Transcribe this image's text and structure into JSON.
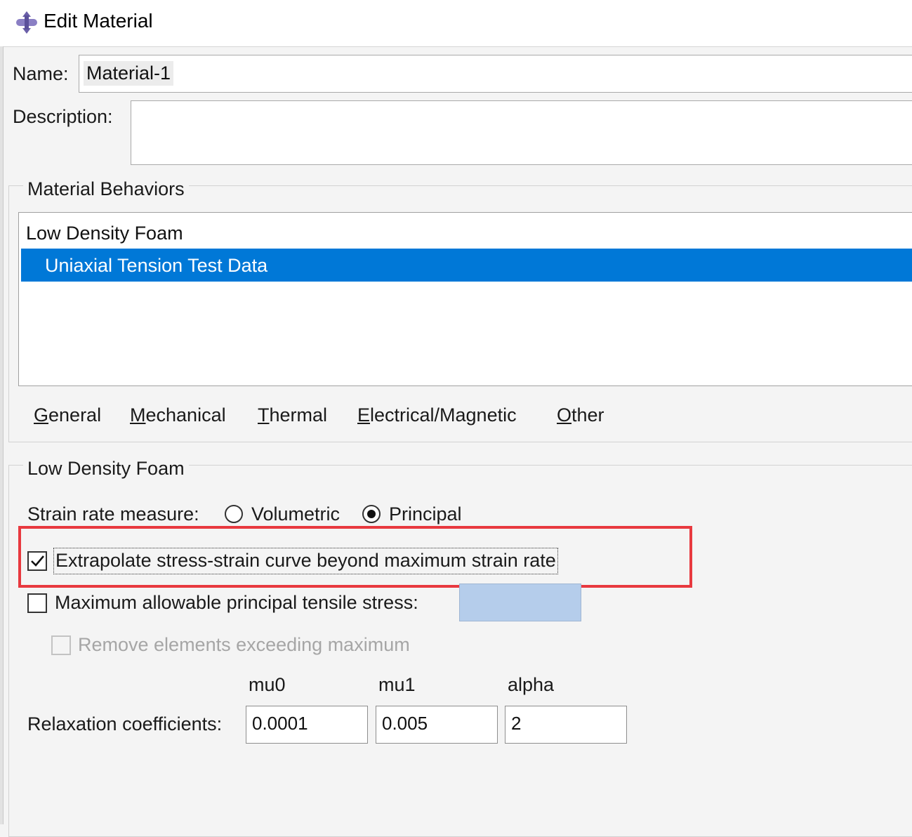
{
  "window": {
    "title": "Edit Material",
    "icon": "material-icon"
  },
  "name_field": {
    "label": "Name:",
    "value": "Material-1"
  },
  "description_field": {
    "label": "Description:",
    "value": ""
  },
  "behaviors_group": {
    "title": "Material Behaviors",
    "items": [
      {
        "label": "Low Density Foam",
        "selected": false
      },
      {
        "label": "Uniaxial Tension Test Data",
        "selected": true
      }
    ]
  },
  "menu": {
    "items": [
      {
        "first": "G",
        "rest": "eneral"
      },
      {
        "first": "M",
        "rest": "echanical"
      },
      {
        "first": "T",
        "rest": "hermal"
      },
      {
        "first": "E",
        "rest": "lectrical/Magnetic"
      },
      {
        "first": "O",
        "rest": "ther"
      }
    ]
  },
  "foam_group": {
    "title": "Low Density Foam",
    "strain_rate": {
      "label": "Strain rate measure:",
      "options": [
        "Volumetric",
        "Principal"
      ],
      "selected": "Principal"
    },
    "extrapolate": {
      "label": "Extrapolate stress-strain curve beyond maximum strain rate",
      "checked": true
    },
    "max_tensile": {
      "label": "Maximum allowable principal tensile stress:",
      "checked": false,
      "value": ""
    },
    "remove_elements": {
      "label": "Remove elements exceeding maximum",
      "checked": false,
      "enabled": false
    },
    "relaxation": {
      "label": "Relaxation coefficients:",
      "columns": [
        "mu0",
        "mu1",
        "alpha"
      ],
      "values": [
        "0.0001",
        "0.005",
        "2"
      ]
    }
  },
  "colors": {
    "selection": "#0078d7",
    "highlight_box": "#e8393f",
    "disabled_field": "#b5cdeb"
  }
}
